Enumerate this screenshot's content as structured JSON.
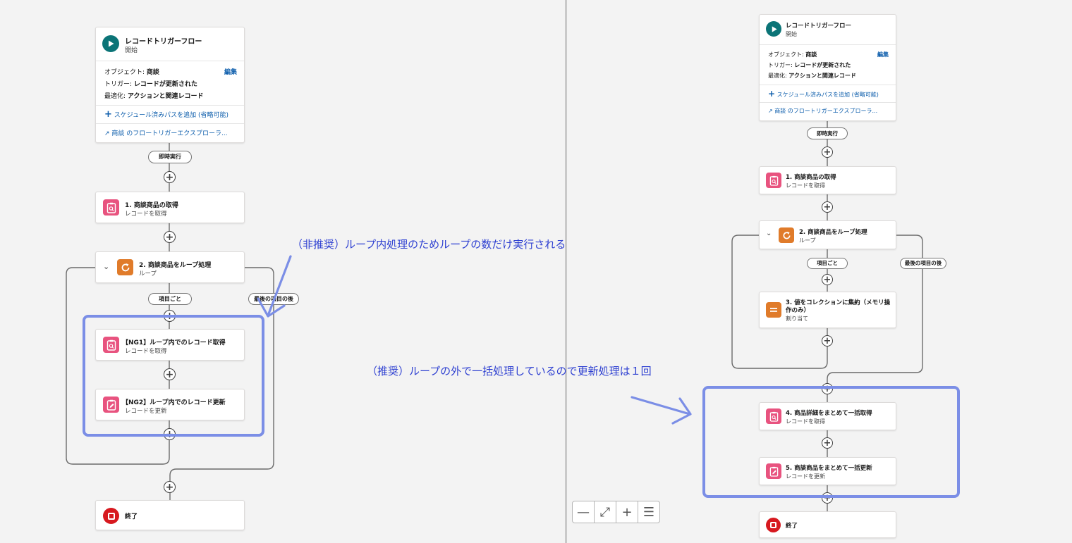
{
  "left": {
    "start": {
      "title": "レコードトリガーフロー",
      "subtitle": "開始",
      "object_label": "オブジェクト:",
      "object_value": "商談",
      "edit_label": "編集",
      "trigger_label": "トリガー:",
      "trigger_value": "レコードが更新された",
      "optimize_label": "最適化:",
      "optimize_value": "アクションと関連レコード",
      "add_path": "スケジュール済みパスを追加 (省略可能)",
      "explorer": "商談 のフロートリガーエクスプローラ..."
    },
    "immediate_label": "即時実行",
    "get_products": {
      "title": "1. 商談商品の取得",
      "subtitle": "レコードを取得"
    },
    "loop": {
      "title": "2. 商談商品をループ処理",
      "subtitle": "ループ"
    },
    "for_each_label": "項目ごと",
    "after_last_label": "最後の項目の後",
    "ng1": {
      "title": "【NG1】ループ内でのレコード取得",
      "subtitle": "レコードを取得"
    },
    "ng2": {
      "title": "【NG2】ループ内でのレコード更新",
      "subtitle": "レコードを更新"
    },
    "end_label": "終了",
    "annotation": "（非推奨）ループ内処理のためループの数だけ実行される"
  },
  "right": {
    "start": {
      "title": "レコードトリガーフロー",
      "subtitle": "開始",
      "object_label": "オブジェクト:",
      "object_value": "商談",
      "edit_label": "編集",
      "trigger_label": "トリガー:",
      "trigger_value": "レコードが更新された",
      "optimize_label": "最適化:",
      "optimize_value": "アクションと関連レコード",
      "add_path": "スケジュール済みパスを追加 (省略可能)",
      "explorer": "商談 のフロートリガーエクスプローラ..."
    },
    "immediate_label": "即時実行",
    "get_products": {
      "title": "1. 商談商品の取得",
      "subtitle": "レコードを取得"
    },
    "loop": {
      "title": "2. 商談商品をループ処理",
      "subtitle": "ループ"
    },
    "for_each_label": "項目ごと",
    "after_last_label": "最後の項目の後",
    "assign": {
      "title_line1": "3. 値をコレクションに集約（メモリ操",
      "title_line2": "作のみ）",
      "subtitle": "割り当て"
    },
    "bulk_get": {
      "title": "4. 商品詳細をまとめて一括取得",
      "subtitle": "レコードを取得"
    },
    "bulk_update": {
      "title": "5. 商談商品をまとめて一括更新",
      "subtitle": "レコードを更新"
    },
    "end_label": "終了",
    "annotation": "（推奨）ループの外で一括処理しているので更新処理は１回"
  },
  "zoom_controls": {
    "zoom_out": "—",
    "fit": "⤢",
    "zoom_in": "+",
    "auto_layout": "☰"
  },
  "colors": {
    "annotation_text": "#2d3fd1",
    "highlight_box": "#7b8ee6",
    "start_icon": "#0b7477",
    "record_icon": "#e8537f",
    "loop_icon": "#e07b2a",
    "end_icon": "#d7191f",
    "link": "#0b5cab"
  }
}
